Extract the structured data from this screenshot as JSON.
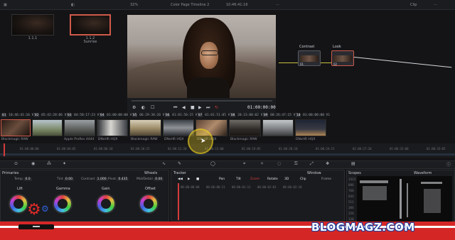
{
  "topbar": {
    "zoom": "32%",
    "title": "Color Page Timeline 2",
    "timecode": "10:46:41:16",
    "clip_menu": "Clip"
  },
  "gallery": {
    "stills": [
      {
        "label": "1.1.1"
      },
      {
        "label": "1.1.2",
        "sublabel": "Sunrise"
      }
    ]
  },
  "viewer": {
    "timecode": "01:00:00:00"
  },
  "nodes": {
    "items": [
      {
        "label": "Contrast",
        "num": "01"
      },
      {
        "label": "Look",
        "num": "02"
      }
    ]
  },
  "clips": {
    "headers": [
      {
        "num": "01",
        "tc": "10:46:41:16",
        "track": "V1"
      },
      {
        "num": "02",
        "tc": "05:42:28:06",
        "track": "V1"
      },
      {
        "num": "03",
        "tc": "04:50:17:23",
        "track": "V1"
      },
      {
        "num": "04",
        "tc": "01:00:00:00",
        "track": "V1"
      },
      {
        "num": "05",
        "tc": "06:29:38:20",
        "track": "V1"
      },
      {
        "num": "06",
        "tc": "01:01:50:15",
        "track": "V1"
      },
      {
        "num": "07",
        "tc": "01:01:51:05",
        "track": "V1"
      },
      {
        "num": "08",
        "tc": "20:23:00:02",
        "track": "V1"
      },
      {
        "num": "09",
        "tc": "00:26:47:15",
        "track": "V1"
      },
      {
        "num": "10",
        "tc": "01:00:00:00",
        "track": "V1"
      }
    ],
    "labels": [
      "Blackmagic RAW",
      "Apple ProRes 4444",
      "DNxHR HQX",
      "Blackmagic RAW",
      "DNxHR HQX",
      "DNxHR HQX",
      "Blackmagic RAW",
      "DNxHR HQX"
    ]
  },
  "ruler": {
    "ticks": [
      "01:00:00:00",
      "01:00:04:05",
      "01:00:06:10",
      "01:00:10:15",
      "01:00:12:20",
      "01:00:15:00",
      "01:00:19:05",
      "01:00:20:10",
      "01:00:24:15",
      "01:00:27:20",
      "01:00:32:00",
      "01:00:33:05"
    ]
  },
  "primaries": {
    "title": "Primaries",
    "mode": "Wheels",
    "params": [
      {
        "name": "Temp",
        "value": "0.0"
      },
      {
        "name": "Tint",
        "value": "0.00"
      },
      {
        "name": "Contrast",
        "value": "1.000"
      },
      {
        "name": "Pivot",
        "value": "0.435"
      },
      {
        "name": "Mid/Detail",
        "value": "0.00"
      }
    ],
    "wheels": [
      "Lift",
      "Gamma",
      "Gain",
      "Offset"
    ]
  },
  "tracker": {
    "title": "Tracker",
    "mode": "Window",
    "options": [
      "Pan",
      "Tilt",
      "Zoom",
      "Rotate",
      "3D"
    ],
    "clip_label": "Clip",
    "frame_label": "Frame",
    "timecodes": [
      "00:00:00:00",
      "00:00:00:21",
      "00:00:01:12",
      "00:00:02:03",
      "00:00:02:18"
    ]
  },
  "scopes": {
    "title": "Scopes",
    "mode": "Waveform",
    "scale": [
      "1023",
      "896",
      "768",
      "640",
      "512",
      "384",
      "256",
      "128"
    ]
  },
  "watermark": {
    "text": "BLOGMAGZ.COM"
  },
  "colors": {
    "accent": "#d05a4a",
    "node_wire": "#c9c23a",
    "watermark_red": "#d52626",
    "watermark_blue": "#1b3fa0"
  }
}
